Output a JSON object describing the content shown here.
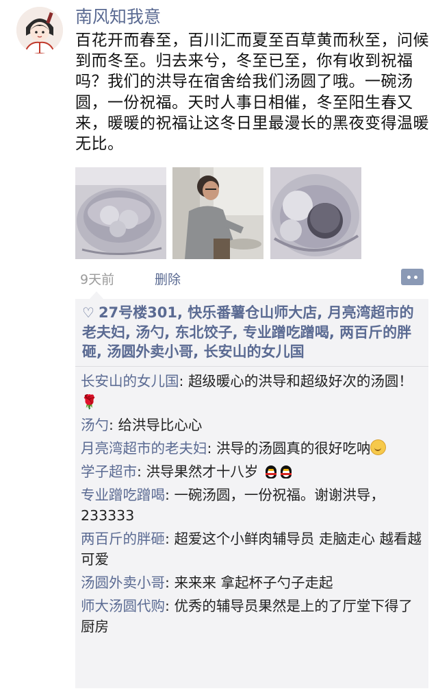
{
  "post": {
    "username": "南风知我意",
    "text": "百花开而春至，百川汇而夏至百草黄而秋至，问候到而冬至。归去来兮，冬至已至，你有收到祝福吗？我们的洪导在宿舍给我们汤圆了哦。一碗汤圆，一份祝福。天时人事日相催，冬至阳生春又来，暖暖的祝福让这冬日里最漫长的黑夜变得温暖无比。",
    "time": "9天前",
    "delete_label": "删除",
    "photos": [
      "photo-tangyuan-bowl",
      "photo-person-at-table",
      "photo-tangyuan-closeup"
    ]
  },
  "likes": {
    "icon": "heart-outline-icon",
    "names": "27号楼301, 快乐番薯仓山师大店, 月亮湾超市的老夫妇, 汤勺, 东北饺子, 专业蹭吃蹭喝, 两百斤的胖砸, 汤圆外卖小哥, 长安山的女儿国"
  },
  "comments": [
    {
      "author": "长安山的女儿国",
      "sep": ": ",
      "text": "超级暖心的洪导和超级好次的汤圆！",
      "emoji": "rose-icon"
    },
    {
      "author": "汤勺",
      "sep": ": ",
      "text": "给洪导比心心"
    },
    {
      "author": "月亮湾超市的老夫妇",
      "sep": ": ",
      "text": "洪导的汤圆真的很好吃呐",
      "emoji": "smile-icon"
    },
    {
      "author": "学子超市",
      "sep": ": ",
      "text": "洪导果然才十八岁",
      "emoji": "penguin-icon"
    },
    {
      "author": "专业蹭吃蹭喝",
      "sep": ": ",
      "text": "一碗汤圆，一份祝福。谢谢洪导，233333"
    },
    {
      "author": "两百斤的胖砸",
      "sep": ": ",
      "text": "超爱这个小鲜肉辅导员 走脑走心 越看越可爱"
    },
    {
      "author": "汤圆外卖小哥",
      "sep": ": ",
      "text": "来来来 拿起杯子勺子走起"
    },
    {
      "author": "师大汤圆代购",
      "sep": ": ",
      "text": "优秀的辅导员果然是上的了厅堂下得了厨房"
    }
  ],
  "colors": {
    "link": "#5a6a92",
    "panel": "#f3f3f5",
    "time": "#9a9a9a"
  }
}
